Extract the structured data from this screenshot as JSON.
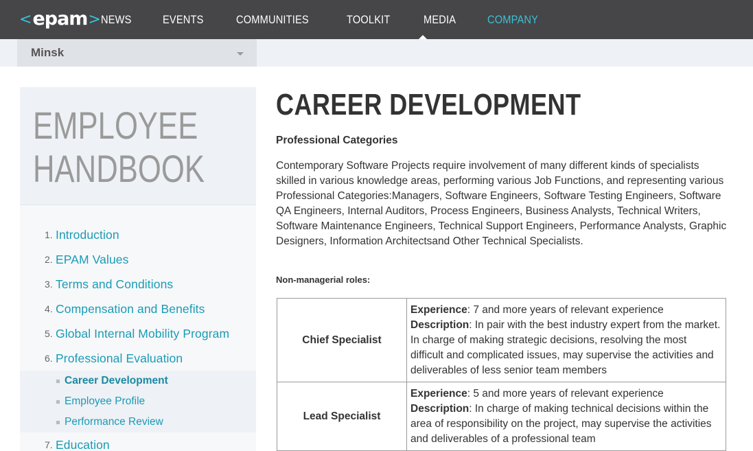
{
  "nav": {
    "logo_text": "epam",
    "items": [
      {
        "label": "News",
        "active": false
      },
      {
        "label": "Events",
        "active": false
      },
      {
        "label": "Communities",
        "active": false
      },
      {
        "label": "Toolkit",
        "active": false
      },
      {
        "label": "Media",
        "active": false
      },
      {
        "label": "Company",
        "active": true
      }
    ],
    "accent_color": "#39c2d7",
    "background_color": "#464547"
  },
  "location": {
    "selected": "Minsk"
  },
  "sidebar": {
    "title_line1": "Employee",
    "title_line2": "Handbook",
    "toc": [
      {
        "num": "1.",
        "label": "Introduction"
      },
      {
        "num": "2.",
        "label": "EPAM Values"
      },
      {
        "num": "3.",
        "label": "Terms and Conditions"
      },
      {
        "num": "4.",
        "label": "Compensation and Benefits"
      },
      {
        "num": "5.",
        "label": "Global Internal Mobility Program"
      },
      {
        "num": "6.",
        "label": "Professional Evaluation"
      },
      {
        "num": "7.",
        "label": "Education"
      }
    ],
    "subitems": [
      {
        "label": "Career Development",
        "current": true
      },
      {
        "label": "Employee Profile",
        "current": false
      },
      {
        "label": "Performance Review",
        "current": false
      }
    ]
  },
  "main": {
    "title": "Career Development",
    "section_heading": "Professional Categories",
    "intro": "Contemporary Software Projects require involvement of many different kinds of specialists skilled in various knowledge areas, performing various Job Functions, and representing various Professional Categories:Managers, Software Engineers, Software Testing Engineers, Software QA Engineers, Internal Auditors, Process Engineers, Business Analysts, Technical Writers, Software Maintenance Engineers, Technical Support Engineers, Performance Analysts, Graphic Designers, Information Architectsand Other Technical Specialists.",
    "roles_heading": "Non-managerial roles:",
    "experience_label": "Experience",
    "description_label": "Description",
    "roles": [
      {
        "name": "Chief Specialist",
        "experience": ": 7 and more years of relevant experience",
        "description": ": In pair with the best industry expert from the market. In charge of making strategic decisions, resolving the most difficult and complicated issues, may supervise the activities and deliverables of less senior team members"
      },
      {
        "name": "Lead Specialist",
        "experience": ": 5 and more years of relevant experience",
        "description": ": In charge of making technical decisions within the area of responsibility on the project, may supervise the activities and deliverables of a professional team"
      }
    ]
  }
}
